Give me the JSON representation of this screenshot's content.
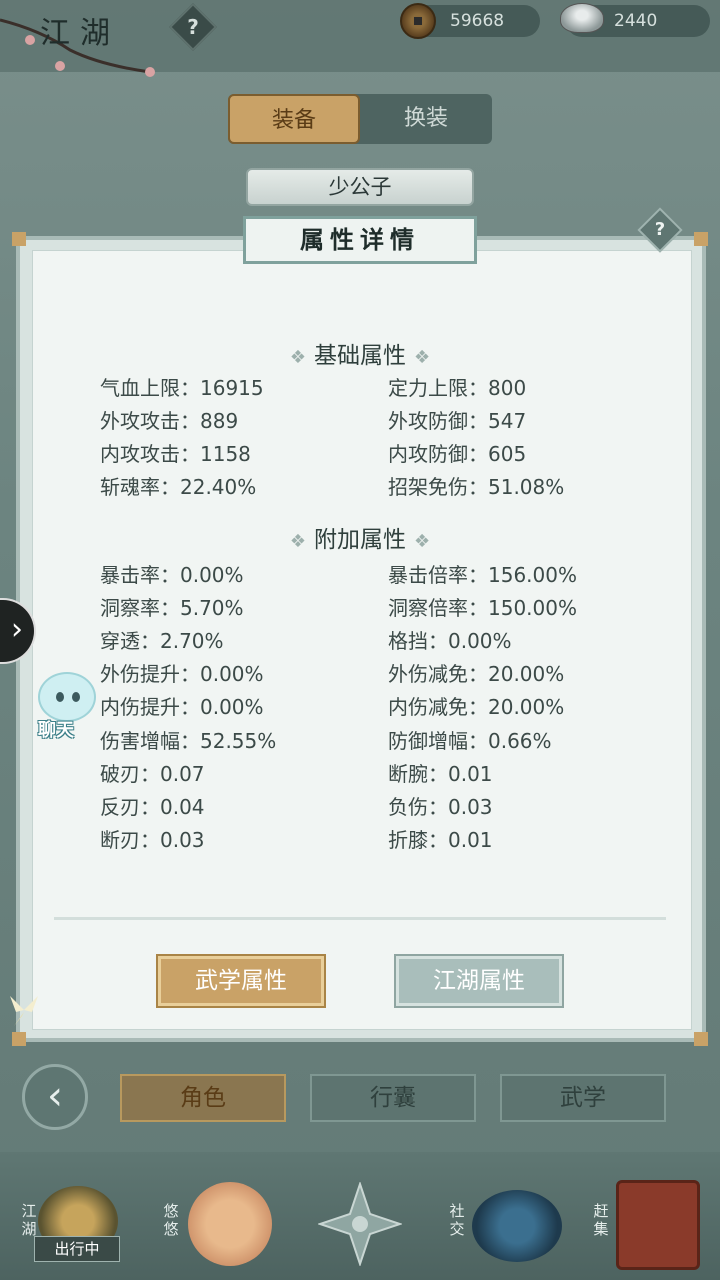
{
  "header": {
    "title": "江湖",
    "coins": "59668",
    "silver": "2440"
  },
  "tabs": {
    "equip": "装备",
    "switch": "换装"
  },
  "character_name": "少公子",
  "panel": {
    "title": "属性详情",
    "basic_title": "基础属性",
    "basic": [
      [
        "气血上限：16915",
        "定力上限：800"
      ],
      [
        "外攻攻击：889",
        "外攻防御：547"
      ],
      [
        "内攻攻击：1158",
        "内攻防御：605"
      ],
      [
        "斩魂率：22.40%",
        "招架免伤：51.08%"
      ]
    ],
    "extra_title": "附加属性",
    "extra": [
      [
        "暴击率：0.00%",
        "暴击倍率：156.00%"
      ],
      [
        "洞察率：5.70%",
        "洞察倍率：150.00%"
      ],
      [
        "穿透：2.70%",
        "格挡：0.00%"
      ],
      [
        "外伤提升：0.00%",
        "外伤减免：20.00%"
      ],
      [
        "内伤提升：0.00%",
        "内伤减免：20.00%"
      ],
      [
        "伤害增幅：52.55%",
        "防御增幅：0.66%"
      ],
      [
        "破刃：0.07",
        "断腕：0.01"
      ],
      [
        "反刃：0.04",
        "负伤：0.03"
      ],
      [
        "断刃：0.03",
        "折膝：0.01"
      ]
    ],
    "btn_martial": "武学属性",
    "btn_jianghu": "江湖属性"
  },
  "chat_label": "聊天",
  "nav": {
    "role": "角色",
    "bag": "行囊",
    "martial": "武学"
  },
  "dock": {
    "jianghu": "江湖",
    "busy": "出行中",
    "youyou": "悠悠",
    "social": "社交",
    "market": "赶集"
  },
  "colors": {
    "gold": "#c9a267",
    "panel": "#f1f5f3",
    "teal": "#6f8783"
  }
}
